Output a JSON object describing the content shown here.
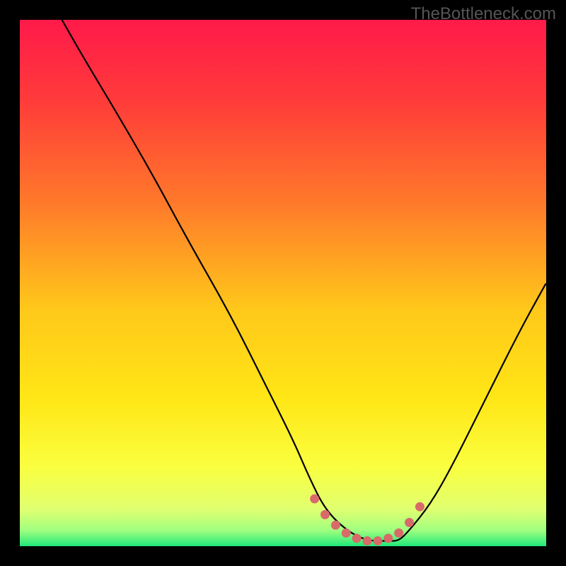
{
  "watermark": "TheBottleneck.com",
  "colors": {
    "black": "#000000",
    "curve": "#000000",
    "marker": "#d86a6a",
    "gradient_stops": [
      {
        "offset": 0.0,
        "color": "#ff1a4a"
      },
      {
        "offset": 0.15,
        "color": "#ff3a3a"
      },
      {
        "offset": 0.35,
        "color": "#ff7a2a"
      },
      {
        "offset": 0.55,
        "color": "#ffc81a"
      },
      {
        "offset": 0.72,
        "color": "#ffe616"
      },
      {
        "offset": 0.85,
        "color": "#faff40"
      },
      {
        "offset": 0.93,
        "color": "#e0ff70"
      },
      {
        "offset": 0.97,
        "color": "#a0ff80"
      },
      {
        "offset": 1.0,
        "color": "#20e87a"
      }
    ]
  },
  "chart_data": {
    "type": "line",
    "title": "",
    "xlabel": "",
    "ylabel": "",
    "xlim": [
      0,
      100
    ],
    "ylim": [
      0,
      100
    ],
    "series": [
      {
        "name": "bottleneck-curve",
        "x": [
          8,
          12,
          18,
          25,
          32,
          40,
          47,
          52,
          55,
          58,
          62,
          66,
          70,
          72,
          74,
          78,
          82,
          88,
          95,
          100
        ],
        "y": [
          100,
          93,
          83,
          71,
          58,
          44,
          30,
          20,
          13,
          7,
          3,
          1,
          1,
          1,
          3,
          8,
          15,
          27,
          41,
          50
        ]
      }
    ],
    "markers": {
      "name": "highlight-band",
      "points": [
        {
          "x": 56,
          "y": 9
        },
        {
          "x": 58,
          "y": 6
        },
        {
          "x": 60,
          "y": 4
        },
        {
          "x": 62,
          "y": 2.5
        },
        {
          "x": 64,
          "y": 1.5
        },
        {
          "x": 66,
          "y": 1
        },
        {
          "x": 68,
          "y": 1
        },
        {
          "x": 70,
          "y": 1.5
        },
        {
          "x": 72,
          "y": 2.5
        },
        {
          "x": 74,
          "y": 4.5
        },
        {
          "x": 76,
          "y": 7.5
        }
      ]
    }
  }
}
